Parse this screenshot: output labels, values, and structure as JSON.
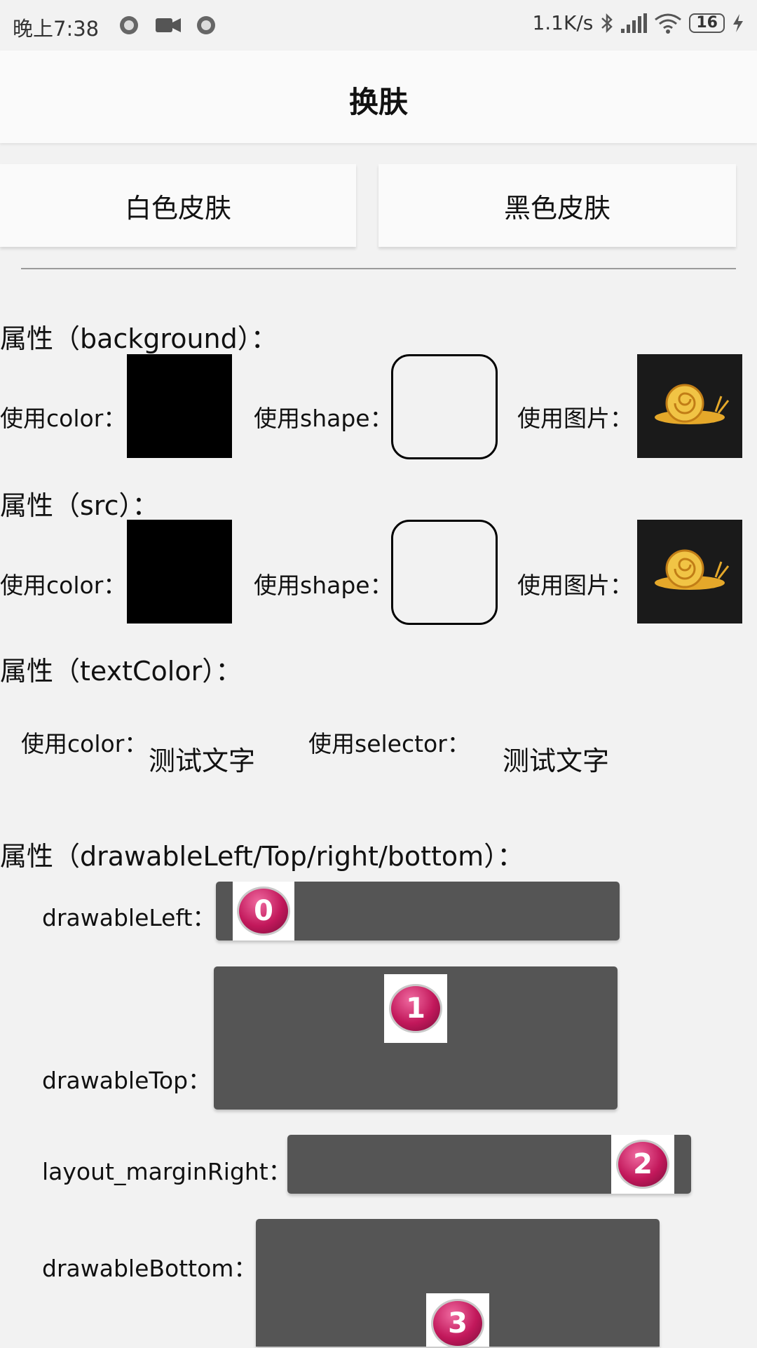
{
  "status_bar": {
    "time": "晚上7:38",
    "net_speed": "1.1K/s",
    "battery": "16"
  },
  "header": {
    "title": "换肤"
  },
  "skin_buttons": {
    "white": "白色皮肤",
    "black": "黑色皮肤"
  },
  "background_section": {
    "title": "属性（background）：",
    "color_label": "使用color：",
    "shape_label": "使用shape：",
    "image_label": "使用图片："
  },
  "src_section": {
    "title": "属性（src）：",
    "color_label": "使用color：",
    "shape_label": "使用shape：",
    "image_label": "使用图片："
  },
  "textcolor_section": {
    "title": "属性（textColor）：",
    "color_label": "使用color：",
    "color_text": "测试文字",
    "selector_label": "使用selector：",
    "selector_text": "测试文字"
  },
  "drawable_section": {
    "title": "属性（drawableLeft/Top/right/bottom）：",
    "left_label": "drawableLeft：",
    "top_label": "drawableTop：",
    "right_label": "layout_marginRight：",
    "bottom_label": "drawableBottom：",
    "icons": [
      "0",
      "1",
      "2",
      "3"
    ]
  },
  "colors": {
    "button_gray": "#555555",
    "icon_magenta": "#c2185b"
  }
}
